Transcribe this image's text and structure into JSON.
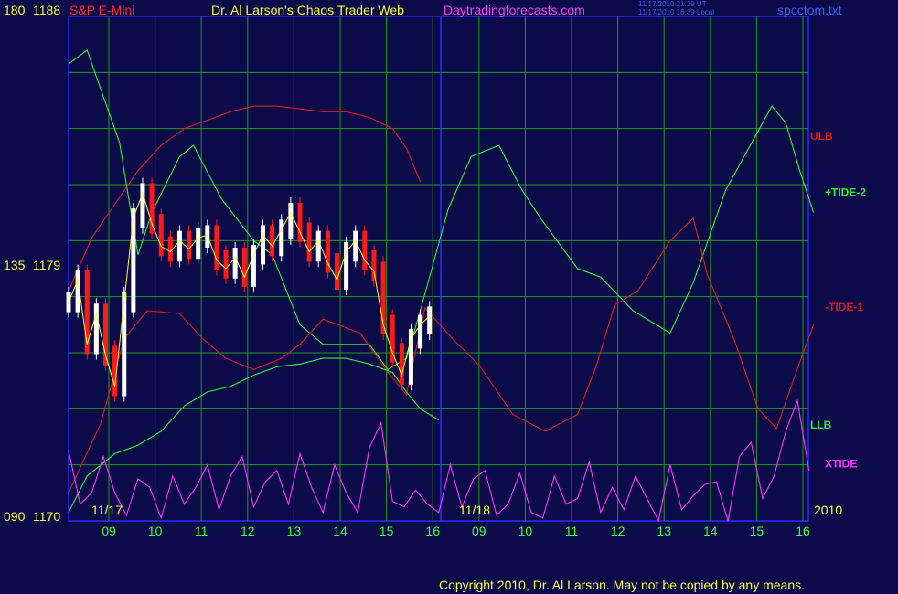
{
  "header": {
    "scale_top": "180",
    "price_top": "1188",
    "symbol": "S&P E-Mini",
    "title": "Dr. Al Larson's Chaos Trader Web",
    "site": "Daytradingforecasts.com",
    "time_ut": "11/17/2010 21:39 UT",
    "time_local": "11/17/2010 16:39 Local",
    "filename": "spcctom.txt"
  },
  "left_axis": {
    "mid_scale": "135",
    "mid_price": "1179",
    "bottom_scale": "090",
    "bottom_price": "1170"
  },
  "date_labels": {
    "day1": "11/17",
    "day2": "11/18",
    "year": "2010"
  },
  "footer": {
    "copyright": "Copyright 2010, Dr. Al Larson. May not be copied by any means."
  },
  "colors": {
    "background": "#0b0b4a",
    "grid": "#1f9a1f",
    "frame": "#2a2aff",
    "price_up": "#ffffff",
    "price_down": "#ff1a1a",
    "tide_plus": "#33ee33",
    "tide_minus": "#e01a1a",
    "xtide": "#ff33ff",
    "band": "#e01a1a",
    "moving_avg": "#ffff33",
    "blue_avg": "#3344ff"
  },
  "chart_data": {
    "type": "line",
    "title": "S&P E-Mini",
    "y_price_range": [
      1170,
      1188
    ],
    "y_scale_range": [
      90,
      180
    ],
    "x_hour_ticks": [
      "09",
      "10",
      "11",
      "12",
      "13",
      "14",
      "15",
      "16",
      "09",
      "10",
      "11",
      "12",
      "13",
      "14",
      "15",
      "16"
    ],
    "y_tick_labels": [
      {
        "scale": "180",
        "price": "1188"
      },
      {
        "scale": "135",
        "price": "1179"
      },
      {
        "scale": "090",
        "price": "1170"
      }
    ],
    "legend_labels": [
      "ULB",
      "+TIDE-2",
      "-TIDE-1",
      "LLB",
      "XTIDE"
    ],
    "series": [
      {
        "name": "+TIDE-2",
        "color": "#33ee33",
        "x": [
          0,
          0.4,
          1.1,
          1.5,
          1.8,
          2.4,
          2.7,
          3.3,
          4.0,
          4.4,
          5.0,
          5.5,
          6.5,
          6.9,
          7.3,
          7.6,
          8.2,
          8.7,
          9.3,
          9.8,
          10.2,
          11.0,
          11.5,
          12.2,
          13.0,
          13.5,
          14.2,
          14.9,
          15.2,
          15.5,
          15.8,
          16.1
        ],
        "values": [
          1186.3,
          1186.8,
          1183.5,
          1179.5,
          1181.0,
          1183.0,
          1183.4,
          1181.5,
          1180.0,
          1179.5,
          1177.0,
          1176.3,
          1176.3,
          1175.4,
          1175.8,
          1177.5,
          1181.1,
          1183.0,
          1183.4,
          1181.8,
          1180.8,
          1179.0,
          1178.7,
          1177.5,
          1176.7,
          1178.5,
          1181.8,
          1183.9,
          1184.8,
          1184.2,
          1182.5,
          1181.0
        ]
      },
      {
        "name": "-TIDE-1",
        "color": "#e01a1a",
        "x": [
          0,
          0.7,
          1.2,
          1.7,
          2.4,
          2.9,
          3.4,
          4.0,
          4.6,
          5.0,
          5.5,
          6.3,
          6.9,
          7.3,
          7.7,
          8.3,
          8.9,
          9.6,
          10.3,
          11.0,
          11.4,
          11.8,
          12.3,
          13.0,
          13.5,
          13.8,
          14.4,
          14.9,
          15.3,
          15.7,
          16.1
        ],
        "values": [
          1171.0,
          1173.5,
          1176.5,
          1177.5,
          1177.4,
          1176.5,
          1175.8,
          1175.4,
          1175.8,
          1176.3,
          1177.2,
          1176.7,
          1175.3,
          1174.5,
          1177.6,
          1176.5,
          1175.5,
          1173.8,
          1173.2,
          1173.8,
          1175.5,
          1177.7,
          1178.2,
          1180.0,
          1180.8,
          1178.8,
          1176.4,
          1174.0,
          1173.3,
          1175.2,
          1177.0
        ]
      },
      {
        "name": "ULB",
        "color": "#e01a1a",
        "x": [
          0,
          0.5,
          1.0,
          1.5,
          2.0,
          2.5,
          3.0,
          3.5,
          4.0,
          4.5,
          5.0,
          5.5,
          6.0,
          6.5,
          7.0,
          7.3,
          7.6
        ],
        "values": [
          1178.2,
          1180.1,
          1181.3,
          1182.5,
          1183.4,
          1184.0,
          1184.3,
          1184.6,
          1184.8,
          1184.8,
          1184.7,
          1184.6,
          1184.6,
          1184.4,
          1184.0,
          1183.3,
          1182.1
        ]
      },
      {
        "name": "LLB",
        "color": "#33ee33",
        "x": [
          0,
          0.4,
          1.0,
          1.5,
          2.0,
          2.5,
          3.0,
          3.5,
          4.0,
          4.5,
          5.0,
          5.5,
          6.0,
          6.5,
          7.0,
          7.3,
          7.6,
          8.0
        ],
        "values": [
          1170.3,
          1171.6,
          1172.4,
          1172.7,
          1173.2,
          1174.1,
          1174.6,
          1174.8,
          1175.2,
          1175.5,
          1175.6,
          1175.8,
          1175.8,
          1175.6,
          1175.3,
          1174.6,
          1174.0,
          1173.6
        ]
      },
      {
        "name": "XTIDE",
        "color": "#ff33ff",
        "x": [
          0,
          0.25,
          0.5,
          0.75,
          1.0,
          1.25,
          1.5,
          1.75,
          2.0,
          2.25,
          2.5,
          2.75,
          3.0,
          3.25,
          3.5,
          3.75,
          4.0,
          4.25,
          4.5,
          4.75,
          5.0,
          5.25,
          5.5,
          5.75,
          6.0,
          6.25,
          6.5,
          6.75,
          7.0,
          7.25,
          7.5,
          7.75,
          8.0,
          8.25,
          8.5,
          8.75,
          9.0,
          9.25,
          9.5,
          9.75,
          10.0,
          10.25,
          10.5,
          10.75,
          11.0,
          11.25,
          11.5,
          11.75,
          12.0,
          12.25,
          12.5,
          12.75,
          13.0,
          13.25,
          13.5,
          13.75,
          14.0,
          14.25,
          14.5,
          14.75,
          15.0,
          15.25,
          15.5,
          15.75,
          16.0
        ],
        "values": [
          1172.5,
          1170.6,
          1171.0,
          1172.3,
          1171.0,
          1170.2,
          1171.5,
          1171.2,
          1170.1,
          1171.6,
          1170.6,
          1171.2,
          1172.0,
          1170.4,
          1171.6,
          1172.3,
          1170.5,
          1171.4,
          1171.8,
          1170.6,
          1172.4,
          1171.2,
          1170.3,
          1172.0,
          1171.0,
          1170.3,
          1172.6,
          1173.5,
          1170.7,
          1170.5,
          1171.1,
          1170.6,
          1170.3,
          1172.0,
          1170.5,
          1171.5,
          1171.8,
          1170.2,
          1170.6,
          1171.7,
          1170.3,
          1170.1,
          1171.6,
          1170.6,
          1170.8,
          1172.1,
          1170.3,
          1171.2,
          1170.4,
          1171.6,
          1170.8,
          1170.0,
          1172.0,
          1170.4,
          1170.9,
          1171.3,
          1171.4,
          1170.0,
          1172.3,
          1172.8,
          1170.8,
          1171.6,
          1173.2,
          1174.3,
          1171.8
        ]
      },
      {
        "name": "price",
        "color": "#ffffff",
        "x": [
          0,
          0.2,
          0.4,
          0.6,
          0.8,
          1.0,
          1.2,
          1.4,
          1.6,
          1.8,
          2.0,
          2.2,
          2.4,
          2.6,
          2.8,
          3.0,
          3.2,
          3.4,
          3.6,
          3.8,
          4.0,
          4.2,
          4.4,
          4.6,
          4.8,
          5.0,
          5.2,
          5.4,
          5.6,
          5.8,
          6.0,
          6.2,
          6.4,
          6.6,
          6.8,
          7.0,
          7.2,
          7.4,
          7.6,
          7.8
        ],
        "values": [
          1177.8,
          1178.6,
          1176.3,
          1177.4,
          1175.9,
          1174.8,
          1177.8,
          1180.8,
          1181.7,
          1180.6,
          1179.8,
          1179.6,
          1180.0,
          1179.7,
          1180.1,
          1180.2,
          1179.3,
          1179.0,
          1179.4,
          1178.7,
          1179.5,
          1180.2,
          1179.8,
          1180.4,
          1181.0,
          1180.3,
          1179.6,
          1180.0,
          1179.2,
          1178.6,
          1179.6,
          1180.0,
          1179.3,
          1178.9,
          1177.0,
          1176.0,
          1175.2,
          1176.5,
          1177.0,
          1177.3
        ]
      }
    ]
  }
}
